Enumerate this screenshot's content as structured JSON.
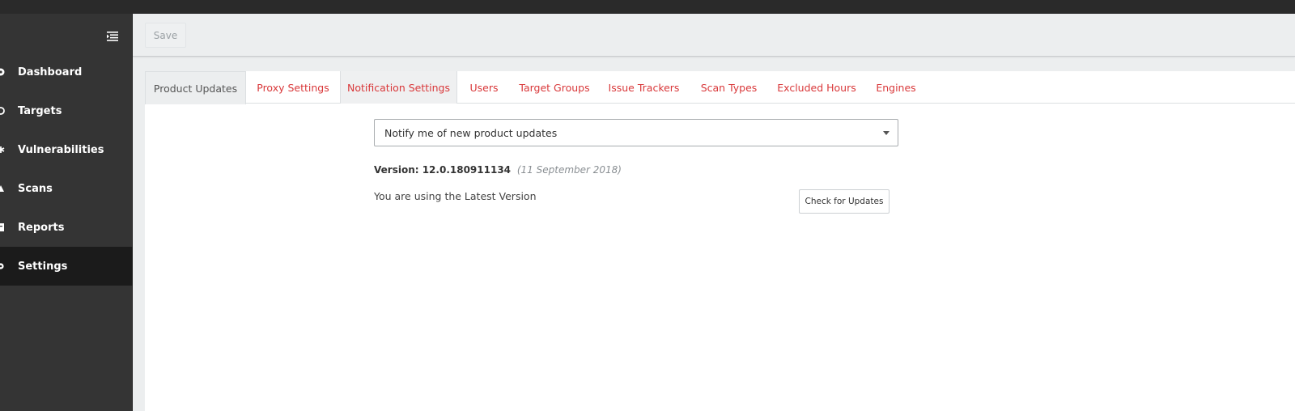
{
  "toolbar": {
    "save_label": "Save"
  },
  "sidebar": {
    "toggle_icon": "menu-collapse-icon",
    "items": [
      {
        "label": "Dashboard",
        "icon": "dashboard-icon"
      },
      {
        "label": "Targets",
        "icon": "target-icon"
      },
      {
        "label": "Vulnerabilities",
        "icon": "bug-icon"
      },
      {
        "label": "Scans",
        "icon": "scan-icon"
      },
      {
        "label": "Reports",
        "icon": "report-icon"
      },
      {
        "label": "Settings",
        "icon": "gear-icon",
        "active": true
      }
    ]
  },
  "tabs": [
    {
      "label": "Product Updates",
      "active": true
    },
    {
      "label": "Proxy Settings"
    },
    {
      "label": "Notification Settings"
    },
    {
      "label": "Users"
    },
    {
      "label": "Target Groups"
    },
    {
      "label": "Issue Trackers"
    },
    {
      "label": "Scan Types"
    },
    {
      "label": "Excluded Hours"
    },
    {
      "label": "Engines"
    }
  ],
  "product_updates": {
    "select_value": "Notify me of new product updates",
    "version_label": "Version: 12.0.180911134",
    "version_date": "(11 September 2018)",
    "status": "You are using the Latest Version",
    "check_button": "Check for Updates"
  },
  "colors": {
    "accent": "#d9383a",
    "sidebar_bg": "#343434",
    "sidebar_active": "#1b1b1b"
  }
}
